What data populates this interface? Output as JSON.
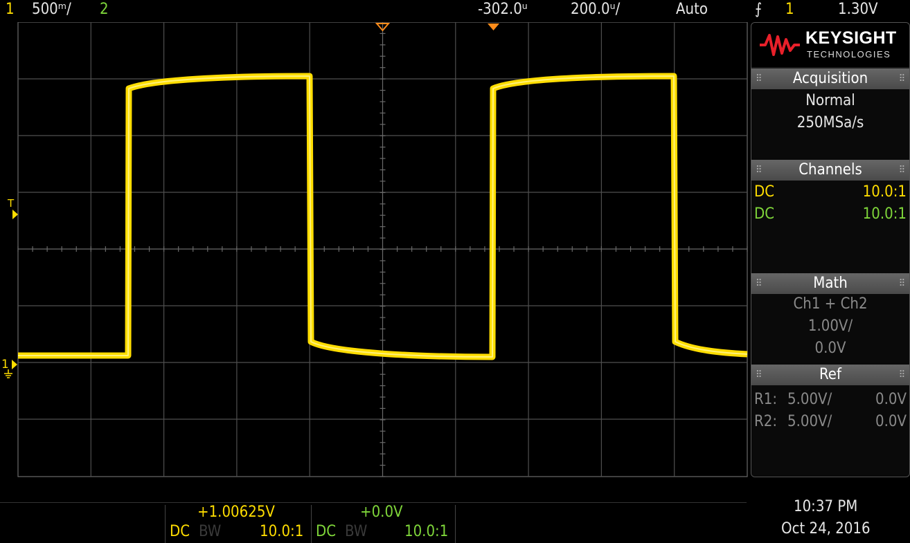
{
  "topbar": {
    "ch1_num": "1",
    "ch1_scale": "500ᵐ/",
    "ch2_num": "2",
    "time_offset": "-302.0ᵘ",
    "time_scale": "200.0ᵘ/",
    "trigger_mode": "Auto",
    "trigger_slope": "⨍",
    "trigger_source": "1",
    "trigger_level": "1.30V"
  },
  "screen": {
    "trigger_marker": "T",
    "ground_marker": "1"
  },
  "panel": {
    "brand": "KEYSIGHT",
    "brand_sub": "TECHNOLOGIES",
    "acquisition": {
      "title": "Acquisition",
      "mode": "Normal",
      "rate": "250MSa/s"
    },
    "channels": {
      "title": "Channels",
      "rows": [
        {
          "coupling": "DC",
          "probe": "10.0:1"
        },
        {
          "coupling": "DC",
          "probe": "10.0:1"
        }
      ]
    },
    "math": {
      "title": "Math",
      "expr": "Ch1 + Ch2",
      "scale": "1.00V/",
      "offset": "0.0V"
    },
    "ref": {
      "title": "Ref",
      "rows": [
        {
          "name": "R1:",
          "scale": "5.00V/",
          "offset": "0.0V"
        },
        {
          "name": "R2:",
          "scale": "5.00V/",
          "offset": "0.0V"
        }
      ]
    }
  },
  "bottom": {
    "ch1": {
      "offset": "+1.00625V",
      "coupling": "DC",
      "bw": "BW",
      "probe": "10.0:1"
    },
    "ch2": {
      "offset": "+0.0V",
      "coupling": "DC",
      "bw": "BW",
      "probe": "10.0:1"
    },
    "time": "10:37 PM",
    "date": "Oct 24, 2016"
  },
  "colors": {
    "ch1": "#ffdd00",
    "ch2": "#7fd63a",
    "trigger": "#ff8c1a",
    "grid": "#5a5a5a"
  }
}
